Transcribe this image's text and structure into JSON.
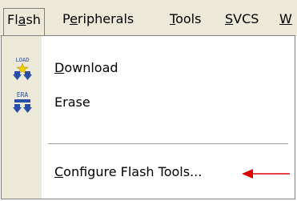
{
  "menubar": {
    "items": [
      {
        "label": "Flash",
        "underline": "a"
      },
      {
        "label": "Peripherals",
        "underline": "e"
      },
      {
        "label": "Tools",
        "underline": "T"
      },
      {
        "label": "SVCS",
        "underline": "S"
      },
      {
        "label": "W",
        "underline": "W"
      }
    ]
  },
  "dropdown": {
    "download": {
      "label_pre": "",
      "label_u": "D",
      "label_post": "ownload",
      "icon_text": "LOAD"
    },
    "erase": {
      "label": "Erase",
      "icon_text": "ERA"
    },
    "configure": {
      "label_pre": "",
      "label_u": "C",
      "label_post": "onfigure Flash Tools..."
    }
  },
  "colors": {
    "arrow": "#e00000",
    "icon_blue": "#2b4fa8",
    "icon_star": "#f2d000"
  }
}
